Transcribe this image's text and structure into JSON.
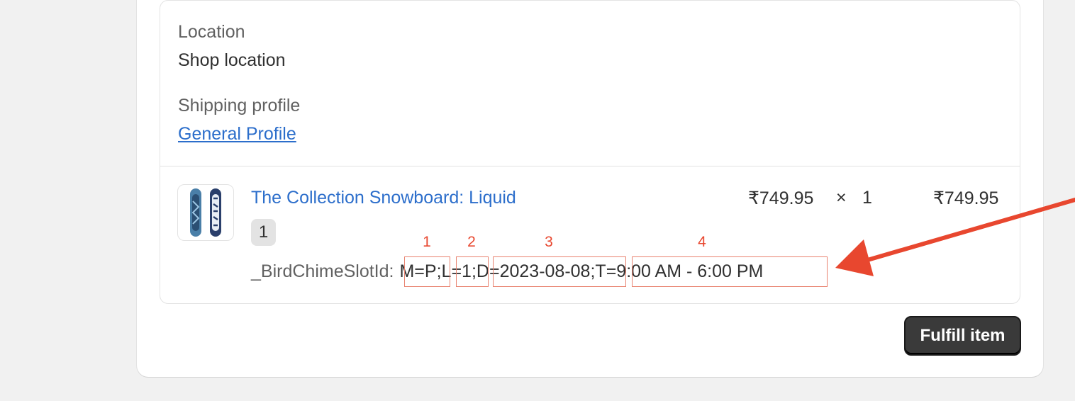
{
  "location": {
    "label": "Location",
    "value": "Shop location"
  },
  "shipping_profile": {
    "label": "Shipping profile",
    "link": "General Profile"
  },
  "line_item": {
    "title": "The Collection Snowboard: Liquid",
    "quantity_badge": "1",
    "unit_price": "₹749.95",
    "times": "×",
    "quantity": "1",
    "total": "₹749.95",
    "property": {
      "key": "_BirdChimeSlotId:",
      "segments": [
        "M=P",
        ";",
        "L=1",
        ";",
        "D=2023-08-08",
        ";",
        "T=9:00 AM - 6:00 PM"
      ]
    }
  },
  "annotations": {
    "numbers": [
      "1",
      "2",
      "3",
      "4"
    ],
    "color": "#e8472f"
  },
  "actions": {
    "fulfill_label": "Fulfill item"
  }
}
